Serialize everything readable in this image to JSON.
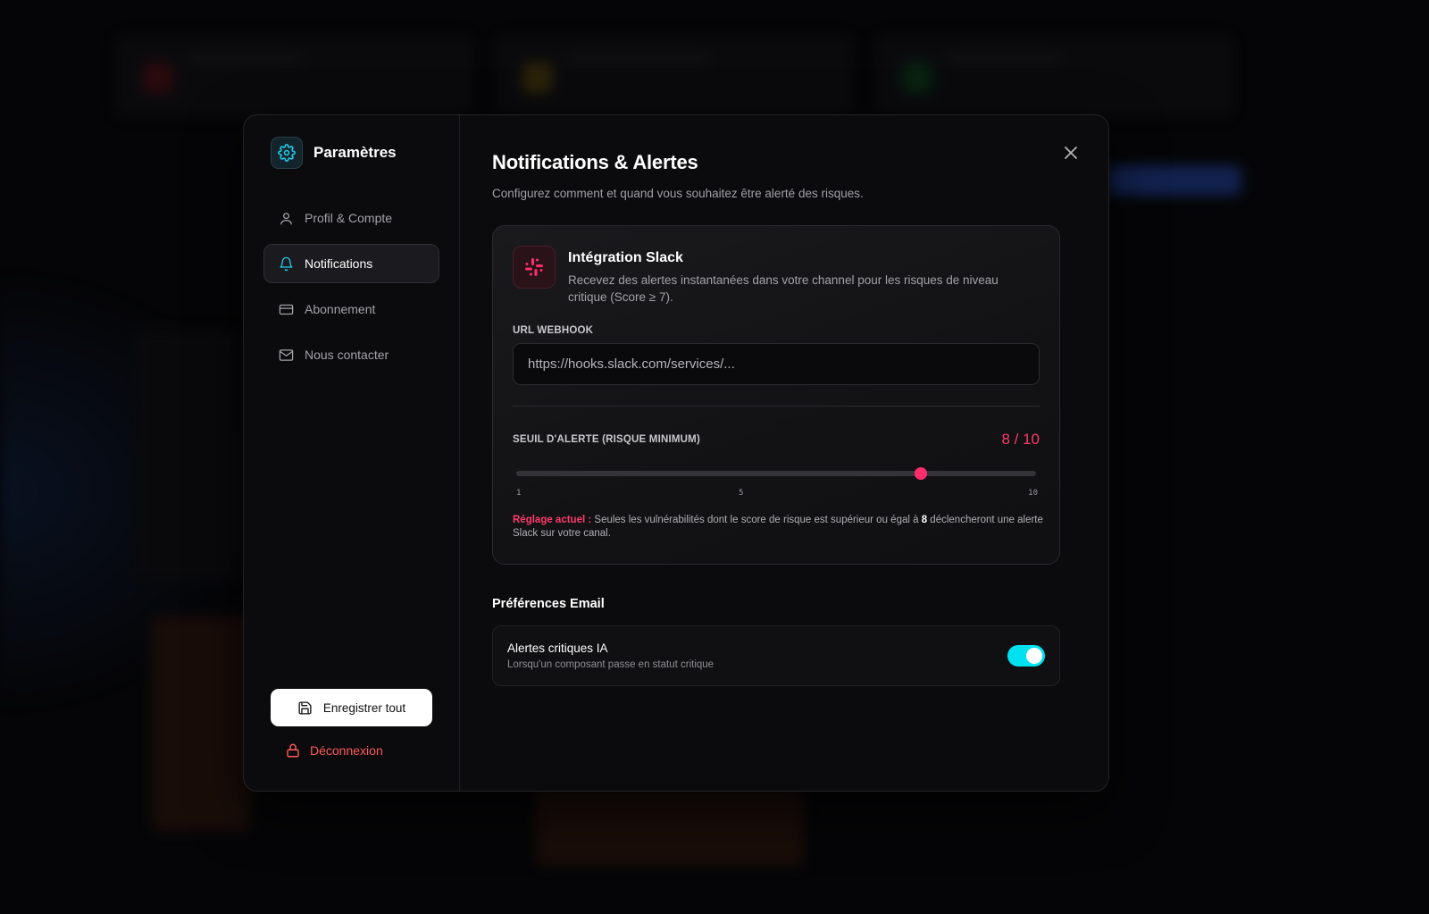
{
  "sidebar": {
    "title": "Paramètres",
    "items": [
      {
        "label": "Profil & Compte",
        "icon": "user-icon"
      },
      {
        "label": "Notifications",
        "icon": "bell-icon",
        "active": true
      },
      {
        "label": "Abonnement",
        "icon": "credit-card-icon"
      },
      {
        "label": "Nous contacter",
        "icon": "mail-icon"
      }
    ],
    "save_label": "Enregistrer tout",
    "logout_label": "Déconnexion"
  },
  "main": {
    "title": "Notifications & Alertes",
    "subtitle": "Configurez comment et quand vous souhaitez être alerté des risques.",
    "slack": {
      "title": "Intégration Slack",
      "description": "Recevez des alertes instantanées dans votre channel pour les risques de niveau critique (Score ≥ 7).",
      "webhook_label": "URL WEBHOOK",
      "webhook_placeholder": "https://hooks.slack.com/services/...",
      "threshold_label": "SEUIL D'ALERTE (RISQUE MINIMUM)",
      "threshold_display": "8 / 10",
      "slider": {
        "min": 1,
        "max": 10,
        "value": 8,
        "ticks": [
          "1",
          "5",
          "10"
        ]
      },
      "note_prefix": "Réglage actuel :",
      "note_before": " Seules les vulnérabilités dont le score de risque est supérieur ou égal à ",
      "note_value": "8",
      "note_after": " déclencheront une alerte Slack sur votre canal."
    },
    "email": {
      "section_title": "Préférences Email",
      "items": [
        {
          "title": "Alertes critiques IA",
          "description": "Lorsqu'un composant passe en statut critique",
          "enabled": true
        }
      ]
    }
  },
  "colors": {
    "accent_cyan": "#00e1f0",
    "accent_pink": "#ff2d6b",
    "danger": "#ff5a5a"
  }
}
